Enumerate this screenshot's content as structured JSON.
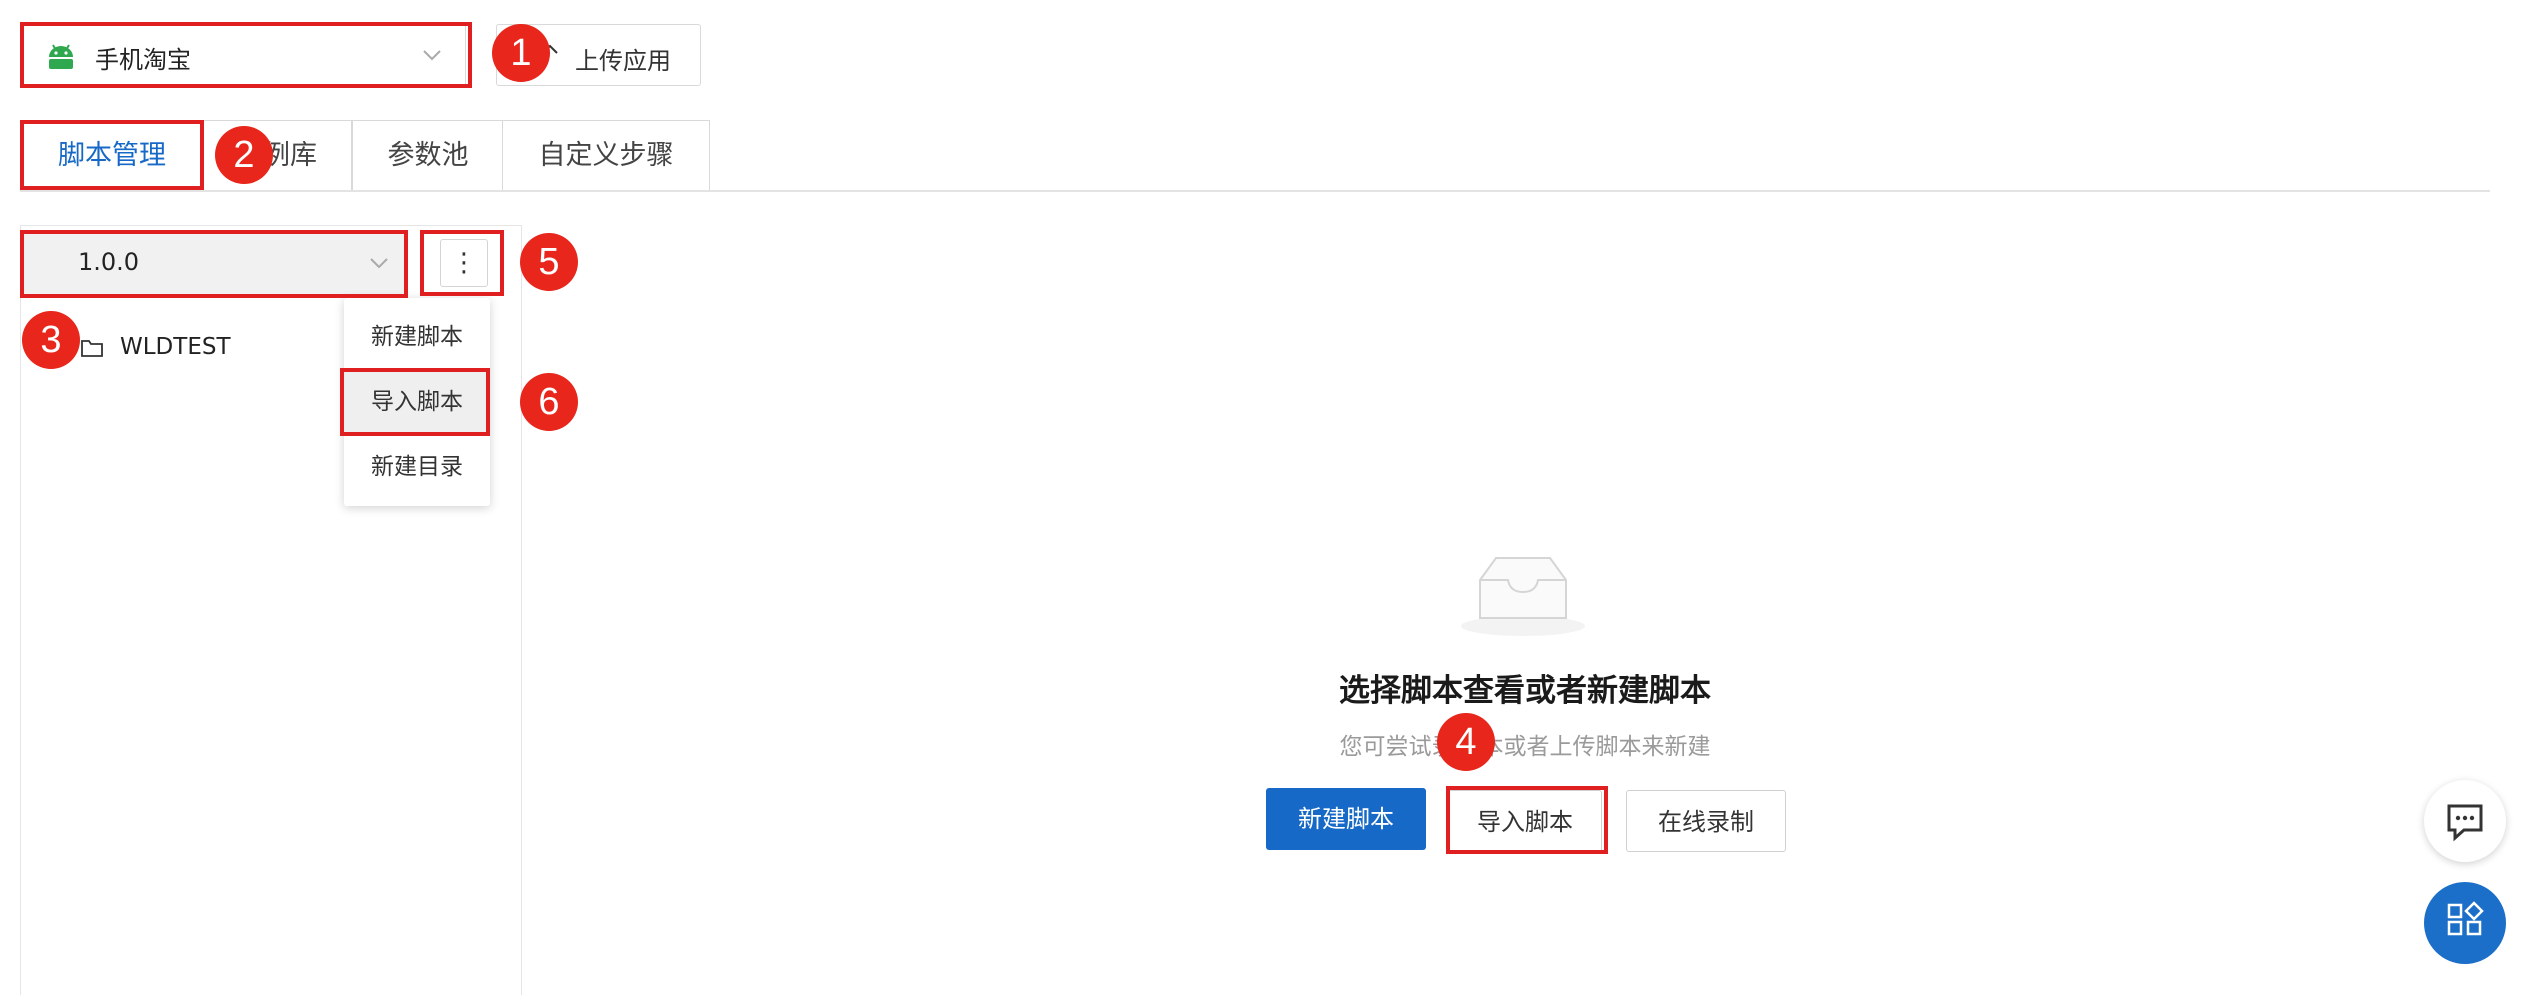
{
  "app_selector": {
    "name": "手机淘宝"
  },
  "upload": {
    "label": "上传应用"
  },
  "tabs": [
    {
      "label": "脚本管理"
    },
    {
      "label": "例库"
    },
    {
      "label": "参数池"
    },
    {
      "label": "自定义步骤"
    }
  ],
  "version_selector": {
    "value": "1.0.0"
  },
  "more_button": {
    "label": "⋮"
  },
  "tree": {
    "items": [
      {
        "label": "WLDTEST"
      }
    ]
  },
  "more_menu": {
    "items": [
      {
        "label": "新建脚本"
      },
      {
        "label": "导入脚本"
      },
      {
        "label": "新建目录"
      }
    ]
  },
  "empty_state": {
    "title": "选择脚本查看或者新建脚本",
    "subtitle_left": "您可尝试录",
    "subtitle_right": "本或者上传脚本来新建"
  },
  "actions": {
    "new_script": "新建脚本",
    "import_script": "导入脚本",
    "online_record": "在线录制"
  },
  "annotations": [
    "1",
    "2",
    "3",
    "4",
    "5",
    "6"
  ],
  "colors": {
    "primary": "#1769c7",
    "annotation_red": "#e8261c",
    "android_green": "#2fa84f"
  }
}
